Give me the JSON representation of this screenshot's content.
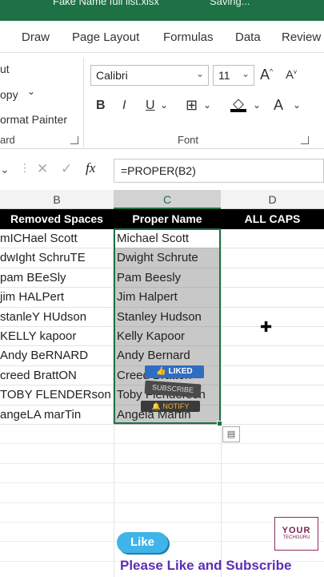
{
  "titlebar": {
    "filename": "Fake Name full list.xlsx",
    "status": "Saving..."
  },
  "tabs": [
    "Draw",
    "Page Layout",
    "Formulas",
    "Data",
    "Review"
  ],
  "clipboard": {
    "cut": "ut",
    "copy": "opy",
    "format_painter": "ormat Painter",
    "label": "ard"
  },
  "font_group": {
    "font_name": "Calibri",
    "font_size": "11",
    "label": "Font",
    "bold": "B",
    "italic": "I",
    "underline": "U"
  },
  "formula_bar": {
    "fx": "fx",
    "formula": "=PROPER(B2)"
  },
  "columns": [
    "B",
    "C",
    "D"
  ],
  "header_row": {
    "b": "Removed Spaces",
    "c": "Proper Name",
    "d": "ALL CAPS"
  },
  "rows": [
    {
      "b": "mICHael Scott",
      "c": "Michael Scott"
    },
    {
      "b": "dwIght SchruTE",
      "c": "Dwight Schrute"
    },
    {
      "b": "pam BEeSly",
      "c": "Pam Beesly"
    },
    {
      "b": "jim HALPert",
      "c": "Jim Halpert"
    },
    {
      "b": "stanleY HUdson",
      "c": "Stanley Hudson"
    },
    {
      "b": "KELLY kapoor",
      "c": "Kelly Kapoor"
    },
    {
      "b": "Andy BeRNARD",
      "c": "Andy Bernard"
    },
    {
      "b": "creed BrattON",
      "c": "Creed Bratton"
    },
    {
      "b": "TOBY FLENDERson",
      "c": "Toby Flenderson"
    },
    {
      "b": "angeLA marTin",
      "c": "Angela Martin"
    }
  ],
  "overlays": {
    "liked": "LIKED",
    "subscribe": "SUBSCRIBE",
    "notify": "NOTIFY"
  },
  "branding": {
    "like": "Like",
    "logo_main": "YOUR",
    "logo_sub": "TECHGURU",
    "banner": "Please Like and Subscribe"
  },
  "colors": {
    "excel_green": "#1e7145",
    "selection_fill": "#c8c8c8",
    "header_black": "#000000"
  }
}
